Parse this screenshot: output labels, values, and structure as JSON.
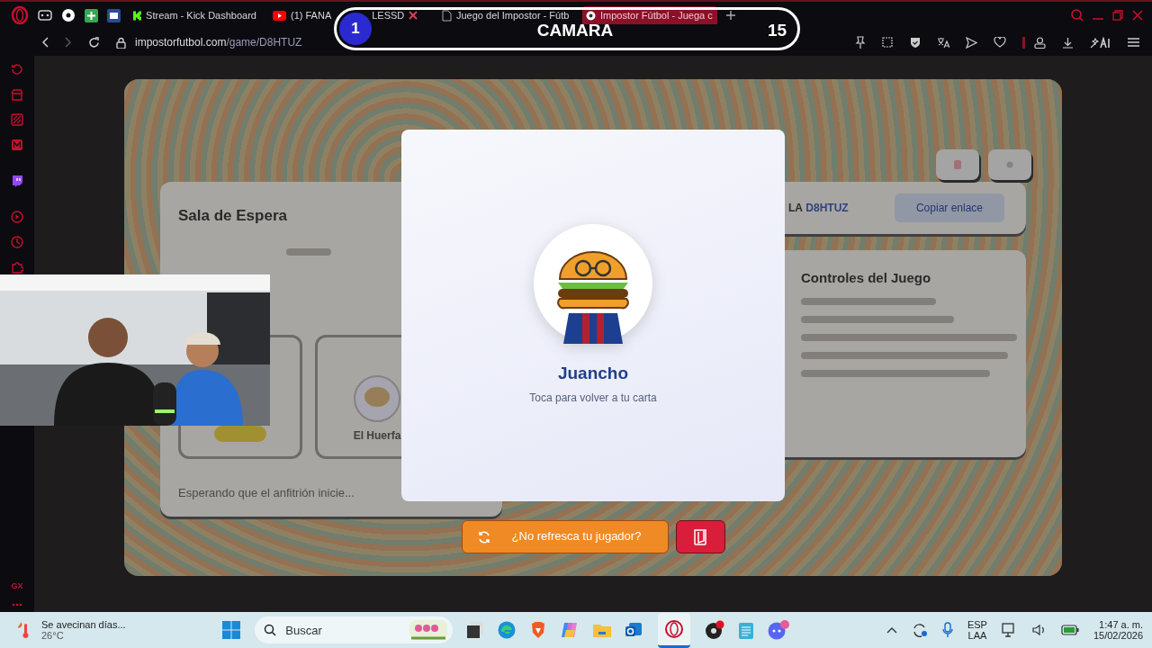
{
  "browser": {
    "tabs": [
      {
        "title": "Stream - Kick Dashboard",
        "kind": "kick",
        "selected": false
      },
      {
        "title": "(1) FANA",
        "title_after": "LESSD",
        "kind": "youtube",
        "selected": false
      },
      {
        "title": "Juego del Impostor - Fútb",
        "kind": "doc",
        "selected": false
      },
      {
        "title": "Impostor Fútbol - Juega c",
        "kind": "ball",
        "selected": true
      }
    ],
    "address": {
      "domain": "impostorfutbol.com",
      "path": "/game/D8HTUZ"
    }
  },
  "stream_overlay": {
    "number": "1",
    "label": "CAMARA",
    "count": "15"
  },
  "sidebar": {
    "badge": "GX"
  },
  "background": {
    "waiting_room": {
      "title": "Sala de Espera",
      "player": "El Huerfa",
      "status": "Esperando que el anfitrión inicie..."
    },
    "room": {
      "label": "LA",
      "code": "D8HTUZ",
      "copy": "Copiar enlace"
    },
    "controls": {
      "title": "Controles del Juego"
    }
  },
  "card": {
    "name": "Juancho",
    "hint": "Toca para volver a tu carta"
  },
  "actions": {
    "refresh": "¿No refresca tu jugador?"
  },
  "taskbar": {
    "weather": {
      "text": "Se avecinan días...",
      "temp": "26°C"
    },
    "search": {
      "placeholder": "Buscar"
    },
    "language": {
      "top": "ESP",
      "bottom": "LAA"
    },
    "clock": {
      "time": "1:47 a. m.",
      "date": "15/02/2026"
    }
  }
}
